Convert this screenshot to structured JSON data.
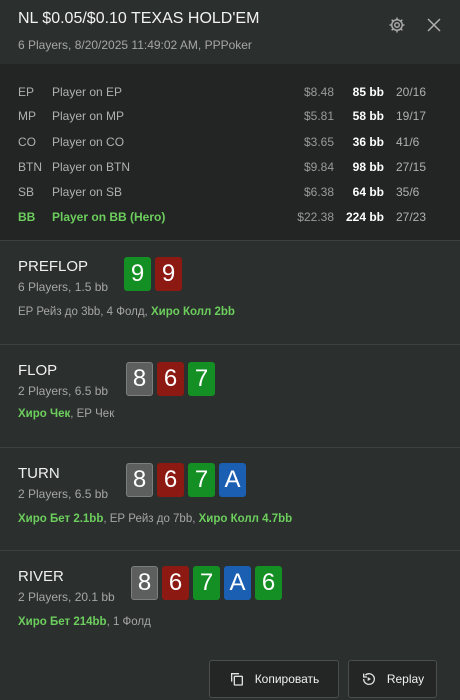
{
  "header": {
    "title": "NL $0.05/$0.10 TEXAS HOLD'EM",
    "subtitle": "6 Players, 8/20/2025 11:49:02 AM, PPPoker",
    "icons": [
      "gear-icon",
      "close-icon"
    ]
  },
  "players": [
    {
      "pos": "EP",
      "name": "Player on EP",
      "usd": "$8.48",
      "bb": "85 bb",
      "stat": "20/16",
      "hero": false
    },
    {
      "pos": "MP",
      "name": "Player on MP",
      "usd": "$5.81",
      "bb": "58 bb",
      "stat": "19/17",
      "hero": false
    },
    {
      "pos": "CO",
      "name": "Player on CO",
      "usd": "$3.65",
      "bb": "36 bb",
      "stat": "41/6",
      "hero": false
    },
    {
      "pos": "BTN",
      "name": "Player on BTN",
      "usd": "$9.84",
      "bb": "98 bb",
      "stat": "27/15",
      "hero": false
    },
    {
      "pos": "SB",
      "name": "Player on SB",
      "usd": "$6.38",
      "bb": "64 bb",
      "stat": "35/6",
      "hero": false
    },
    {
      "pos": "BB",
      "name": "Player on BB (Hero)",
      "usd": "$22.38",
      "bb": "224 bb",
      "stat": "27/23",
      "hero": true
    }
  ],
  "streets": [
    {
      "name": "PREFLOP",
      "info": "6 Players, 1.5 bb",
      "cards": [
        {
          "rank": "9",
          "color": "green"
        },
        {
          "rank": "9",
          "color": "red"
        }
      ],
      "actions": [
        {
          "text": "EP Рейз до 3bb, 4 Фолд, ",
          "hero": false
        },
        {
          "text": "Хиро Колл 2bb",
          "hero": true
        }
      ]
    },
    {
      "name": "FLOP",
      "info": "2 Players, 6.5 bb",
      "cards": [
        {
          "rank": "8",
          "color": "gray"
        },
        {
          "rank": "6",
          "color": "red"
        },
        {
          "rank": "7",
          "color": "green"
        }
      ],
      "actions": [
        {
          "text": "Хиро Чек",
          "hero": true
        },
        {
          "text": ", ЕР Чек",
          "hero": false
        }
      ]
    },
    {
      "name": "TURN",
      "info": "2 Players, 6.5 bb",
      "cards": [
        {
          "rank": "8",
          "color": "gray"
        },
        {
          "rank": "6",
          "color": "red"
        },
        {
          "rank": "7",
          "color": "green"
        },
        {
          "rank": "A",
          "color": "blue"
        }
      ],
      "actions": [
        {
          "text": "Хиро Бет 2.1bb",
          "hero": true
        },
        {
          "text": ", ЕР Рейз до 7bb, ",
          "hero": false
        },
        {
          "text": "Хиро Колл 4.7bb",
          "hero": true
        }
      ]
    },
    {
      "name": "RIVER",
      "info": "2 Players, 20.1 bb",
      "cards": [
        {
          "rank": "8",
          "color": "gray"
        },
        {
          "rank": "6",
          "color": "red"
        },
        {
          "rank": "7",
          "color": "green"
        },
        {
          "rank": "A",
          "color": "blue"
        },
        {
          "rank": "6",
          "color": "green"
        }
      ],
      "actions": [
        {
          "text": "Хиро Бет 214bb",
          "hero": true
        },
        {
          "text": ", 1 Фолд",
          "hero": false
        }
      ]
    }
  ],
  "buttons": {
    "copy_label": "Копировать",
    "replay_label": "Replay"
  },
  "colors": {
    "hero": "#6cce5d",
    "card_green": "#138f24",
    "card_red": "#8c1912",
    "card_gray": "#5c5f5e",
    "card_blue": "#1b5fb3"
  }
}
